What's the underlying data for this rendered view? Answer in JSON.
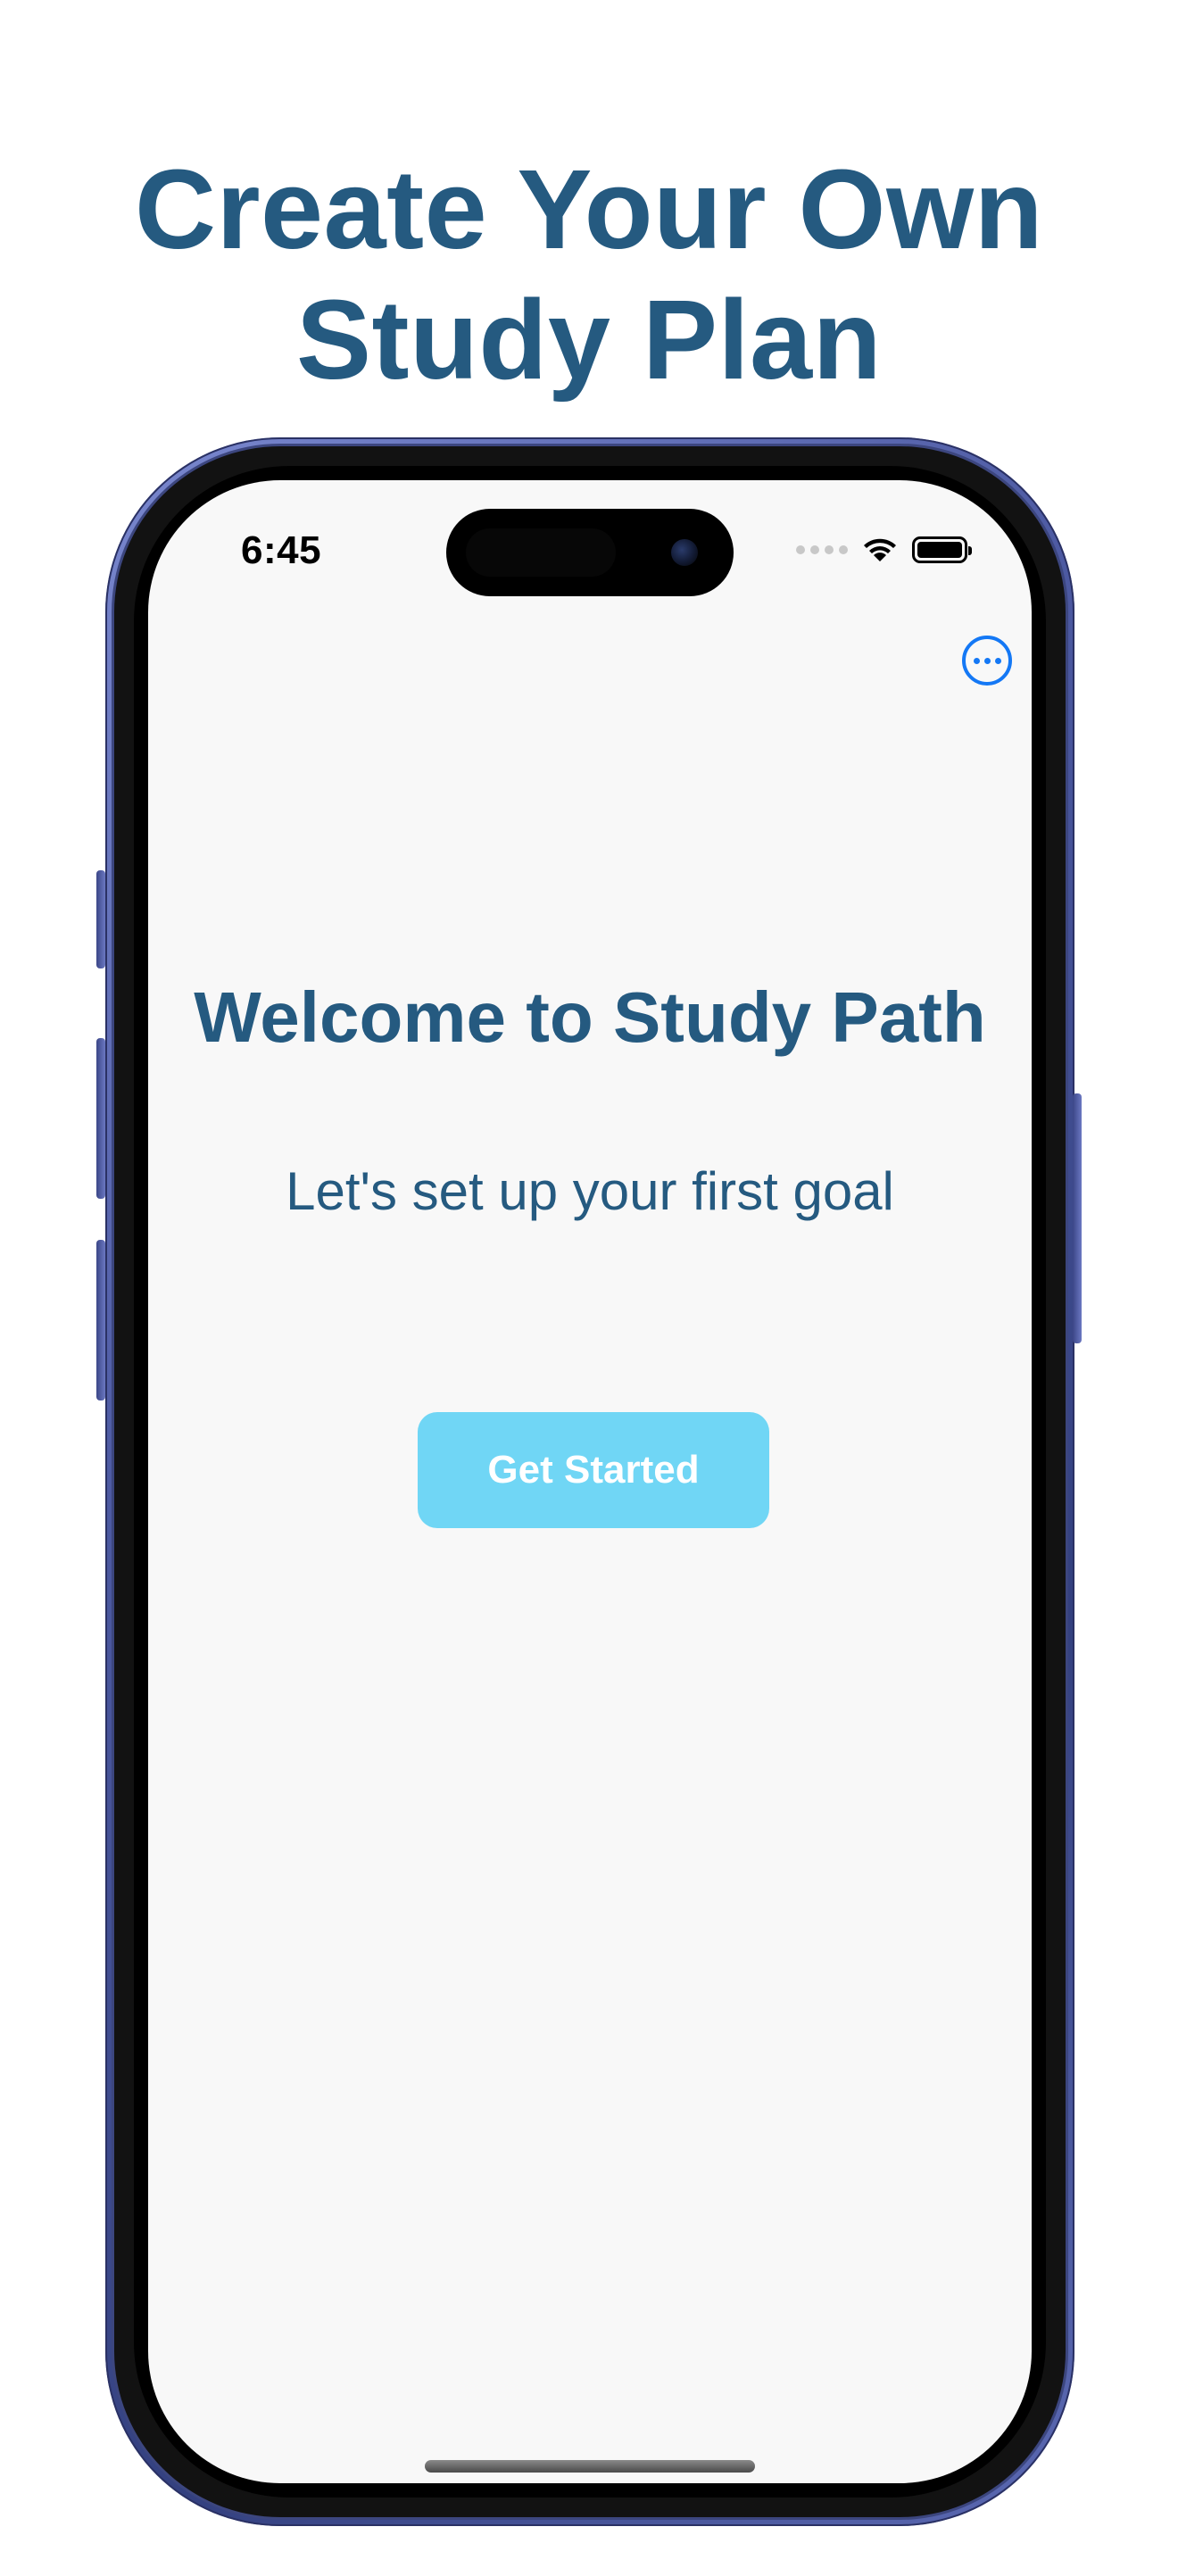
{
  "headline": {
    "line1": "Create Your Own",
    "line2": "Study Plan"
  },
  "status_bar": {
    "time": "6:45",
    "icons": [
      "cellular-signal-icon",
      "wifi-icon",
      "battery-icon"
    ]
  },
  "screen": {
    "more_icon": "ellipsis-circle-icon",
    "title": "Welcome to Study Path",
    "subtitle": "Let's set up your first goal",
    "button_label": "Get Started"
  },
  "colors": {
    "headline": "#255a80",
    "screen_background": "#f8f8f8",
    "button_background": "#70d6f5",
    "button_text": "#ffffff",
    "accent_blue": "#1478f5",
    "phone_frame": "#4d5aa2"
  }
}
